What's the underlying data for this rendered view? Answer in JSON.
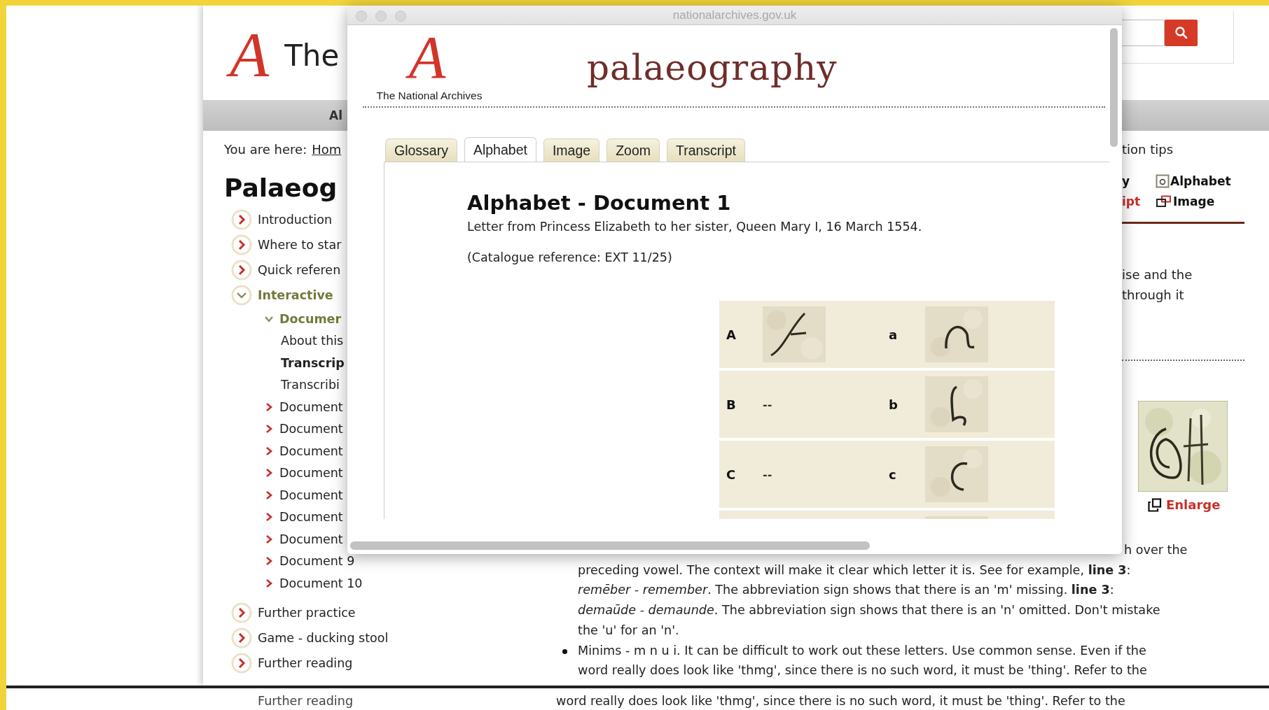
{
  "page": {
    "header": {
      "logo_mark": "A",
      "logo_text": "The"
    },
    "nav": {
      "item": "Al"
    },
    "breadcrumb": {
      "label": "You are here:",
      "link": "Hom"
    },
    "heading": "Palaeog",
    "sidebar": [
      {
        "label": "Introduction",
        "expanded": false
      },
      {
        "label": "Where to star",
        "expanded": false
      },
      {
        "label": "Quick referen",
        "expanded": false
      },
      {
        "label": "Interactive",
        "expanded": true,
        "children": [
          {
            "label": "Documer",
            "expanded": true,
            "children": [
              {
                "label": "About this",
                "selected": false
              },
              {
                "label": "Transcrip",
                "selected": true
              },
              {
                "label": "Transcribi",
                "selected": false
              }
            ]
          },
          {
            "label": "Document",
            "expanded": false
          },
          {
            "label": "Document",
            "expanded": false
          },
          {
            "label": "Document",
            "expanded": false
          },
          {
            "label": "Document",
            "expanded": false
          },
          {
            "label": "Document",
            "expanded": false
          },
          {
            "label": "Document",
            "expanded": false
          },
          {
            "label": "Document",
            "expanded": false
          },
          {
            "label": "Document 9",
            "expanded": false
          },
          {
            "label": "Document 10",
            "expanded": false
          }
        ]
      },
      {
        "label": "Further practice",
        "expanded": false
      },
      {
        "label": "Game - ducking stool",
        "expanded": false
      },
      {
        "label": "Further reading",
        "expanded": false
      }
    ],
    "right_panel": {
      "title": "tion tips",
      "links": [
        {
          "label": "y",
          "selected": false,
          "kind": "plain"
        },
        {
          "label": "Alphabet",
          "selected": false,
          "kind": "letter"
        },
        {
          "label": "ipt",
          "selected": true,
          "kind": "plain"
        },
        {
          "label": "Image",
          "selected": false,
          "kind": "window"
        }
      ],
      "text_lines": [
        "ise and the",
        "through it"
      ],
      "enlarge": "Enlarge"
    },
    "article": {
      "first_line_tail": "h over the",
      "lines": [
        {
          "text": "preceding vowel. The context will make it clear which letter it is. See for example, **line 3**:",
          "bullet": false
        },
        {
          "text": "*remēber - remember*. The abbreviation sign shows that there is an 'm' missing. **line 3**:",
          "bullet": false
        },
        {
          "text": "*demaūde - demaunde*. The abbreviation sign shows that there is an 'n' omitted. Don't mistake",
          "bullet": false
        },
        {
          "text": "the 'u' for an 'n'.",
          "bullet": false
        },
        {
          "text": "Minims - m n u i. It can be difficult to work out these letters. Use common sense. Even if the",
          "bullet": true
        },
        {
          "text": "word really does look like 'thmg', since there is no such word, it must be 'thing'. Refer to the",
          "bullet": false
        }
      ]
    },
    "ghost_strip": {
      "left": "Further reading",
      "right": "word really does look like 'thmg', since there is no such word, it must be 'thing'. Refer to the"
    }
  },
  "popup": {
    "url": "nationalarchives.gov.uk",
    "logo_mark": "A",
    "logo_caption": "The National Archives",
    "title": "palaeography",
    "tabs": [
      {
        "label": "Glossary",
        "selected": false
      },
      {
        "label": "Alphabet",
        "selected": true
      },
      {
        "label": "Image",
        "selected": false
      },
      {
        "label": "Zoom",
        "selected": false
      },
      {
        "label": "Transcript",
        "selected": false
      }
    ],
    "heading": "Alphabet - Document 1",
    "subtitle": "Letter from Princess Elizabeth to her sister, Queen Mary I, 16 March 1554.",
    "reference": "(Catalogue reference: EXT 11/25)",
    "alphabet": [
      {
        "upper": "A",
        "upper_glyph": {
          "kind": "sample"
        },
        "lower": "a",
        "lower_glyph": {
          "kind": "sample"
        }
      },
      {
        "upper": "B",
        "upper_glyph": {
          "kind": "none",
          "text": "--"
        },
        "lower": "b",
        "lower_glyph": {
          "kind": "sample"
        }
      },
      {
        "upper": "C",
        "upper_glyph": {
          "kind": "none",
          "text": "--"
        },
        "lower": "c",
        "lower_glyph": {
          "kind": "sample"
        }
      },
      {
        "lower_glyph": {
          "kind": "sample"
        }
      }
    ]
  }
}
